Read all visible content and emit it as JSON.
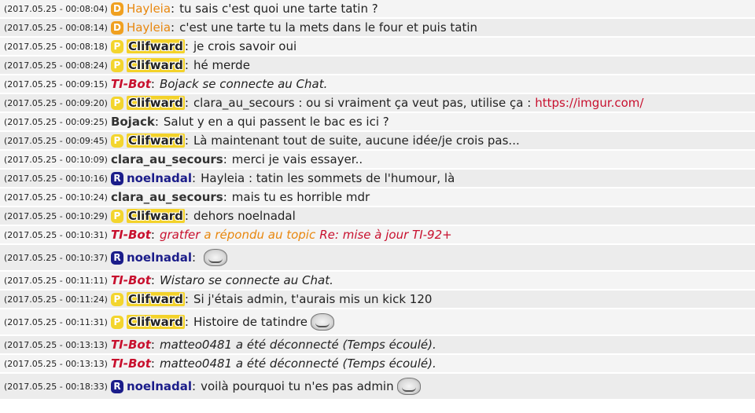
{
  "messages": [
    {
      "ts": "(2017.05.25 - 00:08:04)",
      "badge": "D",
      "user": "Hayleia",
      "sep": ":",
      "text": "tu sais c'est quoi une tarte tatin ?"
    },
    {
      "ts": "(2017.05.25 - 00:08:14)",
      "badge": "D",
      "user": "Hayleia",
      "sep": ":",
      "text": "c'est une tarte tu la mets dans le four et puis tatin"
    },
    {
      "ts": "(2017.05.25 - 00:08:18)",
      "badge": "P",
      "user": "Clifward",
      "sep": ":",
      "text": "je crois savoir oui"
    },
    {
      "ts": "(2017.05.25 - 00:08:24)",
      "badge": "P",
      "user": "Clifward",
      "sep": ":",
      "text": "hé merde"
    },
    {
      "ts": "(2017.05.25 - 00:09:15)",
      "user": "TI-Bot",
      "sep": ":",
      "text": "Bojack se connecte au Chat."
    },
    {
      "ts": "(2017.05.25 - 00:09:20)",
      "badge": "P",
      "user": "Clifward",
      "sep": ":",
      "text": "clara_au_secours : ou si vraiment ça veut pas, utilise ça :",
      "link": "https://imgur.com/"
    },
    {
      "ts": "(2017.05.25 - 00:09:25)",
      "user": "Bojack",
      "sep": ":",
      "text": "Salut y en a qui passent le bac es ici ?"
    },
    {
      "ts": "(2017.05.25 - 00:09:45)",
      "badge": "P",
      "user": "Clifward",
      "sep": ":",
      "text": "Là maintenant tout de suite, aucune idée/je crois pas..."
    },
    {
      "ts": "(2017.05.25 - 00:10:09)",
      "user": "clara_au_secours",
      "sep": ":",
      "text": "merci je vais essayer.."
    },
    {
      "ts": "(2017.05.25 - 00:10:16)",
      "badge": "R",
      "user": "noelnadal",
      "sep": ":",
      "text": "Hayleia : tatin les sommets de l'humour, là"
    },
    {
      "ts": "(2017.05.25 - 00:10:24)",
      "user": "clara_au_secours",
      "sep": ":",
      "text": "mais tu es horrible mdr"
    },
    {
      "ts": "(2017.05.25 - 00:10:29)",
      "badge": "P",
      "user": "Clifward",
      "sep": ":",
      "text": "dehors noelnadal"
    },
    {
      "ts": "(2017.05.25 - 00:10:31)",
      "user": "TI-Bot",
      "sep": ":",
      "parts": [
        "gratfer",
        "a répondu au topic",
        "Re: mise à jour TI-92+"
      ]
    },
    {
      "ts": "(2017.05.25 - 00:10:37)",
      "badge": "R",
      "user": "noelnadal",
      "sep": ":",
      "text": "",
      "emoji": "trollface-icon"
    },
    {
      "ts": "(2017.05.25 - 00:11:11)",
      "user": "TI-Bot",
      "sep": ":",
      "text": "Wistaro se connecte au Chat."
    },
    {
      "ts": "(2017.05.25 - 00:11:24)",
      "badge": "P",
      "user": "Clifward",
      "sep": ":",
      "text": "Si j'étais admin, t'aurais mis un kick 120"
    },
    {
      "ts": "(2017.05.25 - 00:11:31)",
      "badge": "P",
      "user": "Clifward",
      "sep": ":",
      "text": "Histoire de tatindre",
      "emoji": "trollface-icon"
    },
    {
      "ts": "(2017.05.25 - 00:13:13)",
      "user": "TI-Bot",
      "sep": ":",
      "text": "matteo0481 a été déconnecté (Temps écoulé)."
    },
    {
      "ts": "(2017.05.25 - 00:13:13)",
      "user": "TI-Bot",
      "sep": ":",
      "text": "matteo0481 a été déconnecté (Temps écoulé)."
    },
    {
      "ts": "(2017.05.25 - 00:18:33)",
      "badge": "R",
      "user": "noelnadal",
      "sep": ":",
      "text": "voilà pourquoi tu n'es pas admin",
      "emoji": "trollface-icon"
    }
  ],
  "colors": {
    "bot": "#c8102e",
    "hayleia": "#e8870e",
    "clifward_bg": "#f3d22a",
    "noelnadal": "#1b1d8a"
  }
}
